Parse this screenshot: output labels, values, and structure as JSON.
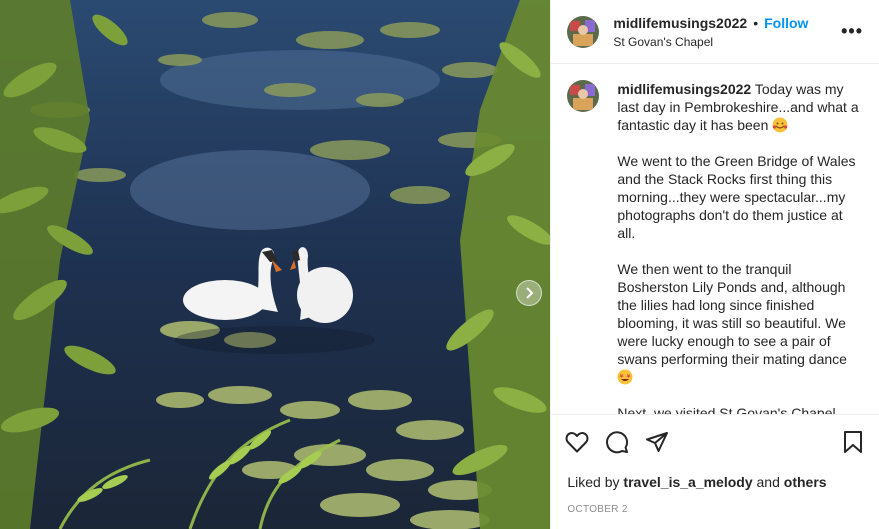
{
  "header": {
    "username": "midlifemusings2022",
    "separator": "•",
    "follow_label": "Follow",
    "location": "St Govan's Chapel",
    "more_label": "•••"
  },
  "caption": {
    "username": "midlifemusings2022",
    "paragraphs": [
      "Today was my last day in Pembrokeshire...and what a fantastic day it has been",
      "We went to the Green Bridge of Wales and the Stack Rocks first thing this morning...they were spectacular...my photographs don't do them justice at all.",
      "We then went to the tranquil Bosherston Lily Ponds and, although the lilies had long since finished blooming, it was still so beautiful. We were lucky enough to see a pair of swans performing their mating dance",
      "Next, we visited St Govan's Chapel,"
    ],
    "emoji": [
      "smiling-face-with-hearts",
      "star-struck"
    ]
  },
  "likes": {
    "prefix": "Liked by",
    "user": "travel_is_a_melody",
    "joiner": "and",
    "others": "others"
  },
  "date": "OCTOBER 2",
  "photo": {
    "subject": "two swans on lily pond",
    "next_icon": "chevron-right-icon"
  },
  "colors": {
    "follow": "#0095f6",
    "muted": "#8e8e8e",
    "water": "#22344a"
  }
}
